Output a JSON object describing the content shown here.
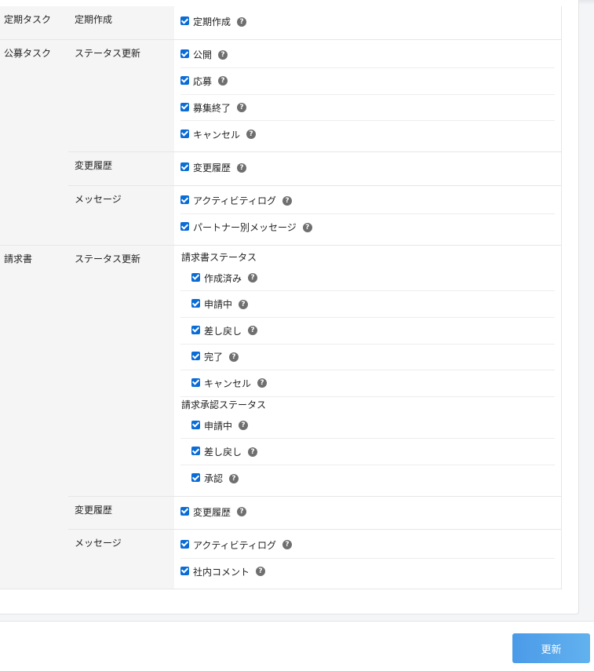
{
  "sections": [
    {
      "category": "定期タスク",
      "groups": [
        {
          "label": "定期作成",
          "items": [
            {
              "label": "定期作成",
              "checked": true
            }
          ]
        }
      ]
    },
    {
      "category": "公募タスク",
      "groups": [
        {
          "label": "ステータス更新",
          "items": [
            {
              "label": "公開",
              "checked": true
            },
            {
              "label": "応募",
              "checked": true
            },
            {
              "label": "募集終了",
              "checked": true
            },
            {
              "label": "キャンセル",
              "checked": true
            }
          ]
        },
        {
          "label": "変更履歴",
          "items": [
            {
              "label": "変更履歴",
              "checked": true
            }
          ]
        },
        {
          "label": "メッセージ",
          "items": [
            {
              "label": "アクティビティログ",
              "checked": true
            },
            {
              "label": "パートナー別メッセージ",
              "checked": true
            }
          ]
        }
      ]
    },
    {
      "category": "請求書",
      "groups": [
        {
          "label": "ステータス更新",
          "subgroups": [
            {
              "label": "請求書ステータス",
              "items": [
                {
                  "label": "作成済み",
                  "checked": true
                },
                {
                  "label": "申請中",
                  "checked": true
                },
                {
                  "label": "差し戻し",
                  "checked": true
                },
                {
                  "label": "完了",
                  "checked": true
                },
                {
                  "label": "キャンセル",
                  "checked": true
                }
              ]
            },
            {
              "label": "請求承認ステータス",
              "items": [
                {
                  "label": "申請中",
                  "checked": true
                },
                {
                  "label": "差し戻し",
                  "checked": true
                },
                {
                  "label": "承認",
                  "checked": true
                }
              ]
            }
          ]
        },
        {
          "label": "変更履歴",
          "items": [
            {
              "label": "変更履歴",
              "checked": true
            }
          ]
        },
        {
          "label": "メッセージ",
          "items": [
            {
              "label": "アクティビティログ",
              "checked": true
            },
            {
              "label": "社内コメント",
              "checked": true
            }
          ]
        }
      ]
    }
  ],
  "help_glyph": "?",
  "footer": {
    "update_label": "更新"
  },
  "colors": {
    "checkbox": "#0a6cd6",
    "button": "#4a9ae8",
    "help_icon": "#6f6f6f"
  }
}
